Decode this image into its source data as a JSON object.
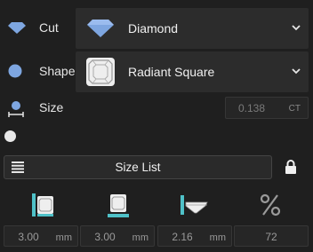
{
  "cut": {
    "label": "Cut",
    "value": "Diamond",
    "icon": "diamond-icon"
  },
  "shape": {
    "label": "Shape",
    "value": "Radiant Square",
    "icon": "circle-icon"
  },
  "size": {
    "label": "Size",
    "value": "0.138",
    "unit": "CT"
  },
  "size_list": {
    "label": "Size List"
  },
  "dimensions": [
    {
      "icon": "width-dimension-icon",
      "value": "3.00",
      "unit": "mm"
    },
    {
      "icon": "length-dimension-icon",
      "value": "3.00",
      "unit": "mm"
    },
    {
      "icon": "depth-dimension-icon",
      "value": "2.16",
      "unit": "mm"
    },
    {
      "icon": "percent-icon",
      "value": "72",
      "unit": ""
    }
  ],
  "colors": {
    "accent": "#4fc1c8",
    "diamond": "#7ea6e0",
    "background": "#1f1f1f"
  }
}
